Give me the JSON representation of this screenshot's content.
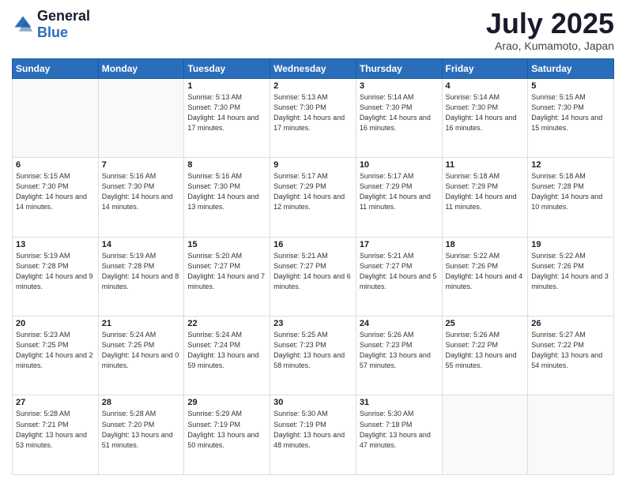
{
  "logo": {
    "general": "General",
    "blue": "Blue"
  },
  "header": {
    "month": "July 2025",
    "location": "Arao, Kumamoto, Japan"
  },
  "weekdays": [
    "Sunday",
    "Monday",
    "Tuesday",
    "Wednesday",
    "Thursday",
    "Friday",
    "Saturday"
  ],
  "weeks": [
    [
      {
        "day": "",
        "info": ""
      },
      {
        "day": "",
        "info": ""
      },
      {
        "day": "1",
        "info": "Sunrise: 5:13 AM\nSunset: 7:30 PM\nDaylight: 14 hours and 17 minutes."
      },
      {
        "day": "2",
        "info": "Sunrise: 5:13 AM\nSunset: 7:30 PM\nDaylight: 14 hours and 17 minutes."
      },
      {
        "day": "3",
        "info": "Sunrise: 5:14 AM\nSunset: 7:30 PM\nDaylight: 14 hours and 16 minutes."
      },
      {
        "day": "4",
        "info": "Sunrise: 5:14 AM\nSunset: 7:30 PM\nDaylight: 14 hours and 16 minutes."
      },
      {
        "day": "5",
        "info": "Sunrise: 5:15 AM\nSunset: 7:30 PM\nDaylight: 14 hours and 15 minutes."
      }
    ],
    [
      {
        "day": "6",
        "info": "Sunrise: 5:15 AM\nSunset: 7:30 PM\nDaylight: 14 hours and 14 minutes."
      },
      {
        "day": "7",
        "info": "Sunrise: 5:16 AM\nSunset: 7:30 PM\nDaylight: 14 hours and 14 minutes."
      },
      {
        "day": "8",
        "info": "Sunrise: 5:16 AM\nSunset: 7:30 PM\nDaylight: 14 hours and 13 minutes."
      },
      {
        "day": "9",
        "info": "Sunrise: 5:17 AM\nSunset: 7:29 PM\nDaylight: 14 hours and 12 minutes."
      },
      {
        "day": "10",
        "info": "Sunrise: 5:17 AM\nSunset: 7:29 PM\nDaylight: 14 hours and 11 minutes."
      },
      {
        "day": "11",
        "info": "Sunrise: 5:18 AM\nSunset: 7:29 PM\nDaylight: 14 hours and 11 minutes."
      },
      {
        "day": "12",
        "info": "Sunrise: 5:18 AM\nSunset: 7:28 PM\nDaylight: 14 hours and 10 minutes."
      }
    ],
    [
      {
        "day": "13",
        "info": "Sunrise: 5:19 AM\nSunset: 7:28 PM\nDaylight: 14 hours and 9 minutes."
      },
      {
        "day": "14",
        "info": "Sunrise: 5:19 AM\nSunset: 7:28 PM\nDaylight: 14 hours and 8 minutes."
      },
      {
        "day": "15",
        "info": "Sunrise: 5:20 AM\nSunset: 7:27 PM\nDaylight: 14 hours and 7 minutes."
      },
      {
        "day": "16",
        "info": "Sunrise: 5:21 AM\nSunset: 7:27 PM\nDaylight: 14 hours and 6 minutes."
      },
      {
        "day": "17",
        "info": "Sunrise: 5:21 AM\nSunset: 7:27 PM\nDaylight: 14 hours and 5 minutes."
      },
      {
        "day": "18",
        "info": "Sunrise: 5:22 AM\nSunset: 7:26 PM\nDaylight: 14 hours and 4 minutes."
      },
      {
        "day": "19",
        "info": "Sunrise: 5:22 AM\nSunset: 7:26 PM\nDaylight: 14 hours and 3 minutes."
      }
    ],
    [
      {
        "day": "20",
        "info": "Sunrise: 5:23 AM\nSunset: 7:25 PM\nDaylight: 14 hours and 2 minutes."
      },
      {
        "day": "21",
        "info": "Sunrise: 5:24 AM\nSunset: 7:25 PM\nDaylight: 14 hours and 0 minutes."
      },
      {
        "day": "22",
        "info": "Sunrise: 5:24 AM\nSunset: 7:24 PM\nDaylight: 13 hours and 59 minutes."
      },
      {
        "day": "23",
        "info": "Sunrise: 5:25 AM\nSunset: 7:23 PM\nDaylight: 13 hours and 58 minutes."
      },
      {
        "day": "24",
        "info": "Sunrise: 5:26 AM\nSunset: 7:23 PM\nDaylight: 13 hours and 57 minutes."
      },
      {
        "day": "25",
        "info": "Sunrise: 5:26 AM\nSunset: 7:22 PM\nDaylight: 13 hours and 55 minutes."
      },
      {
        "day": "26",
        "info": "Sunrise: 5:27 AM\nSunset: 7:22 PM\nDaylight: 13 hours and 54 minutes."
      }
    ],
    [
      {
        "day": "27",
        "info": "Sunrise: 5:28 AM\nSunset: 7:21 PM\nDaylight: 13 hours and 53 minutes."
      },
      {
        "day": "28",
        "info": "Sunrise: 5:28 AM\nSunset: 7:20 PM\nDaylight: 13 hours and 51 minutes."
      },
      {
        "day": "29",
        "info": "Sunrise: 5:29 AM\nSunset: 7:19 PM\nDaylight: 13 hours and 50 minutes."
      },
      {
        "day": "30",
        "info": "Sunrise: 5:30 AM\nSunset: 7:19 PM\nDaylight: 13 hours and 48 minutes."
      },
      {
        "day": "31",
        "info": "Sunrise: 5:30 AM\nSunset: 7:18 PM\nDaylight: 13 hours and 47 minutes."
      },
      {
        "day": "",
        "info": ""
      },
      {
        "day": "",
        "info": ""
      }
    ]
  ]
}
